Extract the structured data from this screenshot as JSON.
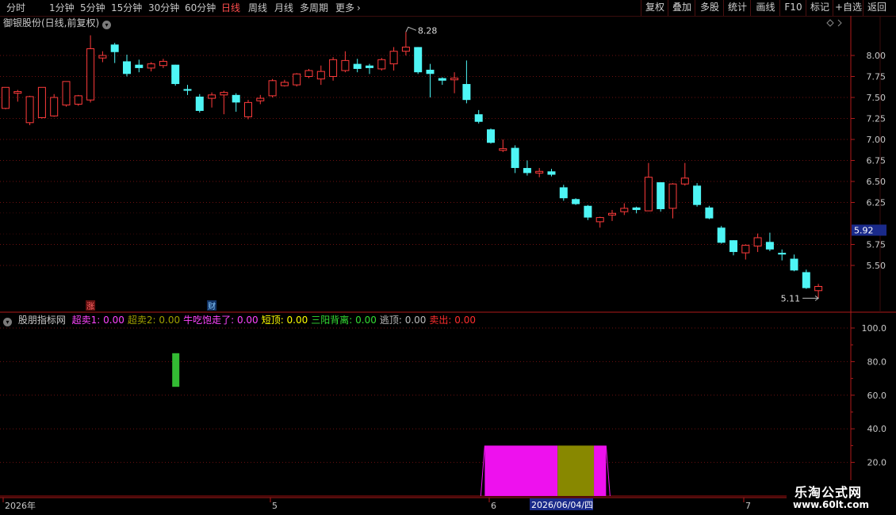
{
  "toolbar": {
    "periods": [
      "分时",
      "1分钟",
      "5分钟",
      "15分钟",
      "30分钟",
      "60分钟",
      "日线",
      "周线",
      "月线",
      "多周期",
      "更多"
    ],
    "active_period": "日线",
    "right_buttons": [
      "复权",
      "叠加",
      "多股",
      "统计",
      "画线",
      "F10",
      "标记",
      "+自选",
      "返回"
    ]
  },
  "main_pane": {
    "stock_title": "御银股份(日线,前复权)",
    "high_label": "8.28",
    "low_label": "5.11",
    "price_tag": "5.92",
    "event_marks": [
      "涨",
      "财"
    ],
    "colors": {
      "up": "#ff3b3b",
      "down": "#4ef5f5",
      "axis": "#b01a1a",
      "grid": "#6e1010"
    }
  },
  "indicator_pane": {
    "name": "股朋指标网",
    "items": [
      {
        "label": "超卖1:",
        "value": "0.00",
        "color": "#ff44ff"
      },
      {
        "label": "超卖2:",
        "value": "0.00",
        "color": "#a0a000"
      },
      {
        "label": "牛吃饱走了:",
        "value": "0.00",
        "color": "#ff44ff"
      },
      {
        "label": "短顶:",
        "value": "0.00",
        "color": "#ffff00"
      },
      {
        "label": "三阳背离:",
        "value": "0.00",
        "color": "#33dd33"
      },
      {
        "label": "逃顶:",
        "value": "0.00",
        "color": "#bbbbbb"
      },
      {
        "label": "卖出:",
        "value": "0.00",
        "color": "#ff2d2d"
      }
    ]
  },
  "x_axis": {
    "labels": [
      "2026年",
      "5",
      "6",
      "7"
    ],
    "cursor_date": "2026/06/04/四"
  },
  "watermark": {
    "line1": "乐淘公式网",
    "line2": "www.60lt.com"
  },
  "chart_data": [
    {
      "type": "candlestick",
      "title": "御银股份(日线,前复权)",
      "ylim": [
        5.2,
        8.3
      ],
      "yticks": [
        8.0,
        7.75,
        7.5,
        7.25,
        7.0,
        6.75,
        6.5,
        6.25,
        5.75,
        5.5
      ],
      "high_mark": 8.28,
      "low_mark": 5.11,
      "current_price": 5.92,
      "candles": [
        [
          7.37,
          7.62,
          7.62,
          7.36
        ],
        [
          7.55,
          7.57,
          7.59,
          7.45
        ],
        [
          7.2,
          7.51,
          7.52,
          7.17
        ],
        [
          7.26,
          7.62,
          7.62,
          7.25
        ],
        [
          7.28,
          7.5,
          7.54,
          7.27
        ],
        [
          7.41,
          7.69,
          7.69,
          7.39
        ],
        [
          7.42,
          7.52,
          7.53,
          7.4
        ],
        [
          7.47,
          8.08,
          8.24,
          7.44
        ],
        [
          7.97,
          8.0,
          8.05,
          7.92
        ],
        [
          8.13,
          8.04,
          8.15,
          7.91
        ],
        [
          7.93,
          7.78,
          8.01,
          7.75
        ],
        [
          7.89,
          7.85,
          7.95,
          7.8
        ],
        [
          7.85,
          7.9,
          7.92,
          7.81
        ],
        [
          7.88,
          7.93,
          7.96,
          7.85
        ],
        [
          7.89,
          7.66,
          7.89,
          7.64
        ],
        [
          7.6,
          7.58,
          7.65,
          7.53
        ],
        [
          7.51,
          7.34,
          7.54,
          7.32
        ],
        [
          7.49,
          7.53,
          7.56,
          7.38
        ],
        [
          7.53,
          7.56,
          7.58,
          7.3
        ],
        [
          7.53,
          7.44,
          7.55,
          7.33
        ],
        [
          7.27,
          7.44,
          7.47,
          7.24
        ],
        [
          7.46,
          7.49,
          7.53,
          7.42
        ],
        [
          7.52,
          7.7,
          7.72,
          7.5
        ],
        [
          7.64,
          7.68,
          7.71,
          7.63
        ],
        [
          7.65,
          7.78,
          7.79,
          7.63
        ],
        [
          7.75,
          7.82,
          7.84,
          7.73
        ],
        [
          7.72,
          7.81,
          7.88,
          7.65
        ],
        [
          7.75,
          7.95,
          7.98,
          7.7
        ],
        [
          7.82,
          7.94,
          8.05,
          7.8
        ],
        [
          7.9,
          7.84,
          7.96,
          7.8
        ],
        [
          7.88,
          7.85,
          7.9,
          7.78
        ],
        [
          7.84,
          7.95,
          7.97,
          7.82
        ],
        [
          7.9,
          8.05,
          8.1,
          7.82
        ],
        [
          8.05,
          8.1,
          8.28,
          8.0
        ],
        [
          8.1,
          7.8,
          8.1,
          7.78
        ],
        [
          7.83,
          7.78,
          7.9,
          7.5
        ],
        [
          7.73,
          7.7,
          7.74,
          7.65
        ],
        [
          7.71,
          7.73,
          7.8,
          7.55
        ],
        [
          7.66,
          7.47,
          7.94,
          7.43
        ],
        [
          7.3,
          7.21,
          7.35,
          7.19
        ],
        [
          7.12,
          6.96,
          7.13,
          6.95
        ],
        [
          6.87,
          6.89,
          7.0,
          6.85
        ],
        [
          6.9,
          6.66,
          6.93,
          6.6
        ],
        [
          6.66,
          6.6,
          6.75,
          6.57
        ],
        [
          6.6,
          6.62,
          6.66,
          6.55
        ],
        [
          6.62,
          6.58,
          6.65,
          6.56
        ],
        [
          6.43,
          6.3,
          6.46,
          6.27
        ],
        [
          6.29,
          6.23,
          6.3,
          6.22
        ],
        [
          6.21,
          6.07,
          6.22,
          6.04
        ],
        [
          6.02,
          6.07,
          6.08,
          5.95
        ],
        [
          6.1,
          6.12,
          6.16,
          6.03
        ],
        [
          6.14,
          6.18,
          6.24,
          6.1
        ],
        [
          6.19,
          6.16,
          6.2,
          6.12
        ],
        [
          6.15,
          6.55,
          6.72,
          6.15
        ],
        [
          6.49,
          6.17,
          6.49,
          6.14
        ],
        [
          6.18,
          6.47,
          6.48,
          6.06
        ],
        [
          6.47,
          6.54,
          6.72,
          6.45
        ],
        [
          6.45,
          6.22,
          6.48,
          6.2
        ],
        [
          6.19,
          6.06,
          6.21,
          6.05
        ],
        [
          5.95,
          5.77,
          5.97,
          5.76
        ],
        [
          5.8,
          5.66,
          5.8,
          5.62
        ],
        [
          5.65,
          5.74,
          5.75,
          5.57
        ],
        [
          5.73,
          5.83,
          5.88,
          5.66
        ],
        [
          5.78,
          5.69,
          5.89,
          5.67
        ],
        [
          5.65,
          5.63,
          5.69,
          5.56
        ],
        [
          5.58,
          5.44,
          5.63,
          5.43
        ],
        [
          5.42,
          5.23,
          5.45,
          5.22
        ],
        [
          5.2,
          5.25,
          5.28,
          5.11
        ]
      ]
    },
    {
      "type": "bar",
      "title": "股朋指标网",
      "ylim": [
        0,
        100
      ],
      "yticks": [
        100,
        80,
        60,
        40,
        20
      ],
      "series": [
        {
          "name": "超卖1",
          "color": "#33bb33",
          "bars": [
            {
              "from": 14,
              "to": 14,
              "value": 85,
              "base": 65
            }
          ]
        },
        {
          "name": "卖出",
          "color": "#ee11ee",
          "bars": [
            {
              "from": 40,
              "to": 45,
              "value": 30,
              "base": 0
            },
            {
              "from": 49,
              "to": 49,
              "value": 30,
              "base": 0
            }
          ]
        },
        {
          "name": "超卖2",
          "color": "#888800",
          "bars": [
            {
              "from": 46,
              "to": 48,
              "value": 30,
              "base": 0
            }
          ]
        }
      ]
    }
  ]
}
